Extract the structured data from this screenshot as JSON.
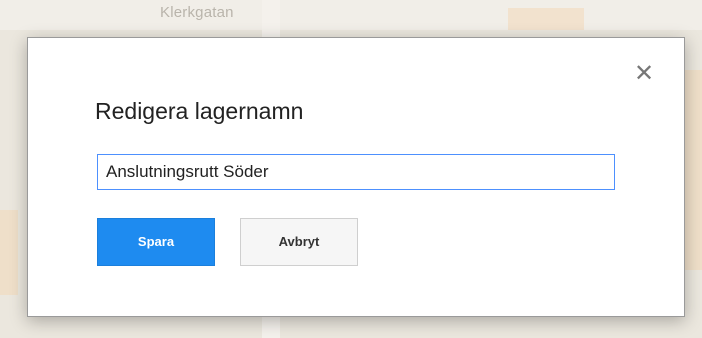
{
  "map": {
    "street_label_top": "Klerkgatan",
    "street_label_vertical": ""
  },
  "dialog": {
    "title": "Redigera lagernamn",
    "input_value": "Anslutningsrutt Söder",
    "close_glyph": "✕",
    "save_label": "Spara",
    "cancel_label": "Avbryt",
    "accent_color": "#1e8bf0",
    "focus_color": "#4d90fe"
  }
}
